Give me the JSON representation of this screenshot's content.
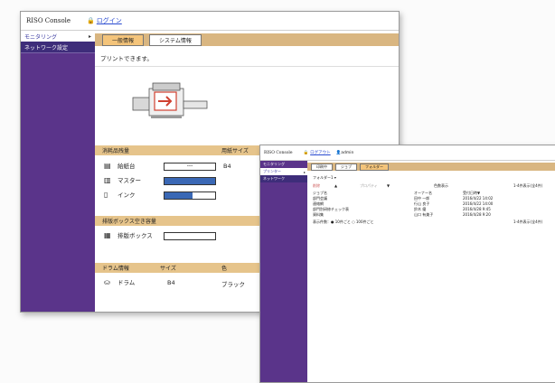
{
  "console1": {
    "app_title": "RISO Console",
    "lock_icon": "lock-icon",
    "login_label": "ログイン",
    "sidebar": {
      "items": [
        {
          "label": "モニタリング",
          "arrow": "▸"
        },
        {
          "label": "ネットワーク設定"
        }
      ]
    },
    "tabs": [
      "一般情報",
      "システム情報"
    ],
    "status_text": "プリントできます。",
    "consumables": {
      "header": "消耗品残量",
      "col_size": "用紙サイズ",
      "col_amount": "枚数",
      "rows": [
        {
          "icon": "paper-tray-icon",
          "label": "給紙台",
          "gauge_text": "---",
          "size": "B4",
          "level": 0
        },
        {
          "icon": "master-icon",
          "label": "マスター",
          "level": 1.0
        },
        {
          "icon": "ink-icon",
          "label": "インク",
          "level": 0.55
        }
      ]
    },
    "disposal": {
      "header": "排版ボックス空き容量",
      "rows": [
        {
          "icon": "disposal-box-icon",
          "label": "排版ボックス",
          "level": 0.0
        }
      ]
    },
    "drum": {
      "header": "ドラム情報",
      "col_size": "サイズ",
      "col_color": "色",
      "rows": [
        {
          "icon": "drum-icon",
          "label": "ドラム",
          "size": "B4",
          "color": "ブラック"
        }
      ]
    }
  },
  "console2": {
    "app_title": "RISO Console",
    "logout_label": "ログアウト",
    "user_label": "admin",
    "sidebar": {
      "items": [
        {
          "label": "モニタリング"
        },
        {
          "label": "プリンター",
          "arrow": "▸"
        },
        {
          "label": "ネットワーク"
        }
      ]
    },
    "tabs": [
      "印刷中",
      "ジョブ",
      "フォルダー"
    ],
    "folder_label": "フォルダー1",
    "folder_arrow": "▾",
    "toolbar": [
      "削除",
      "▲",
      "プロパティ",
      "▼",
      "色数表示"
    ],
    "page_info": "1-4件表示(全4件)",
    "columns": [
      "ジョブ名",
      "オーナー名",
      "受付日時▼"
    ],
    "jobs": [
      {
        "name": "部門会議",
        "owner": "田中 一郎",
        "date": "2016/4/22 14:02"
      },
      {
        "name": "連絡網",
        "owner": "行山 良子",
        "date": "2016/4/22 14:00"
      },
      {
        "name": "部門別研修チェック表",
        "owner": "鈴木 優",
        "date": "2016/4/28 9:45"
      },
      {
        "name": "資料集",
        "owner": "山口 有美子",
        "date": "2016/4/28 9:20"
      }
    ],
    "footer_left": "表示件数：● 10件ごと ○ 100件ごと",
    "footer_right": "1-4件表示(全4件)"
  }
}
